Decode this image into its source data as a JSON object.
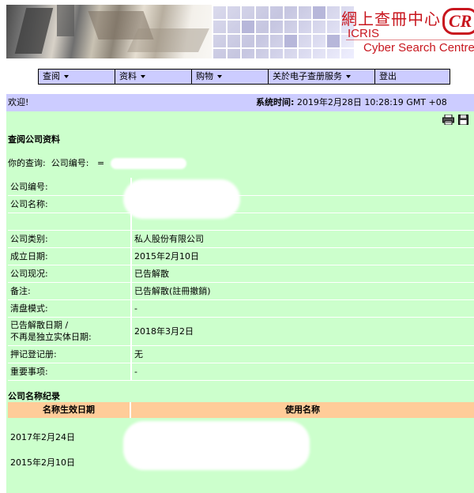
{
  "banner": {
    "title_cn": "網上查冊中心",
    "title_en_1": "ICRIS",
    "title_en_2": "Cyber Search Centre",
    "logo_text": "CR"
  },
  "nav": {
    "items": [
      {
        "label": "查阅",
        "has_dropdown": true
      },
      {
        "label": "资料",
        "has_dropdown": true
      },
      {
        "label": "购物",
        "has_dropdown": true
      },
      {
        "label": "关於电子查册服务",
        "has_dropdown": true
      },
      {
        "label": "登出",
        "has_dropdown": false
      }
    ]
  },
  "welcome": {
    "greeting": "欢迎!",
    "time_label": "系统时间:",
    "time_value": "2019年2月28日 10:28:19 GMT +08"
  },
  "toolbar": {
    "print_icon": "printer-icon",
    "save_icon": "floppy-disk-icon"
  },
  "company_section": {
    "title": "查阅公司资料",
    "query_label": "你的查询:",
    "query_field": "公司编号:",
    "query_op": "="
  },
  "details": {
    "rows": [
      {
        "label": "公司编号:",
        "value": ""
      },
      {
        "label": "公司名称:",
        "value": ""
      },
      {
        "label": "公司类别:",
        "value": "私人股份有限公司"
      },
      {
        "label": "成立日期:",
        "value": "2015年2月10日"
      },
      {
        "label": "公司现况:",
        "value": "已告解散"
      },
      {
        "label": "备注:",
        "value": "已告解散(註冊撤銷)"
      },
      {
        "label": "清盘模式:",
        "value": "-"
      },
      {
        "label": "已告解散日期 / 不再是独立实体日期:",
        "label_line1": "已告解散日期 /",
        "label_line2": "不再是独立实体日期:",
        "value": "2018年3月2日"
      },
      {
        "label": "押记登记册:",
        "value": "无"
      },
      {
        "label": "重要事项:",
        "value": "-"
      }
    ]
  },
  "name_history": {
    "title": "公司名称纪录",
    "headers": [
      "名称生效日期",
      "使用名称"
    ],
    "rows": [
      {
        "date": "2017年2月24日",
        "name": ""
      },
      {
        "date": "2015年2月10日",
        "name": ""
      }
    ]
  }
}
